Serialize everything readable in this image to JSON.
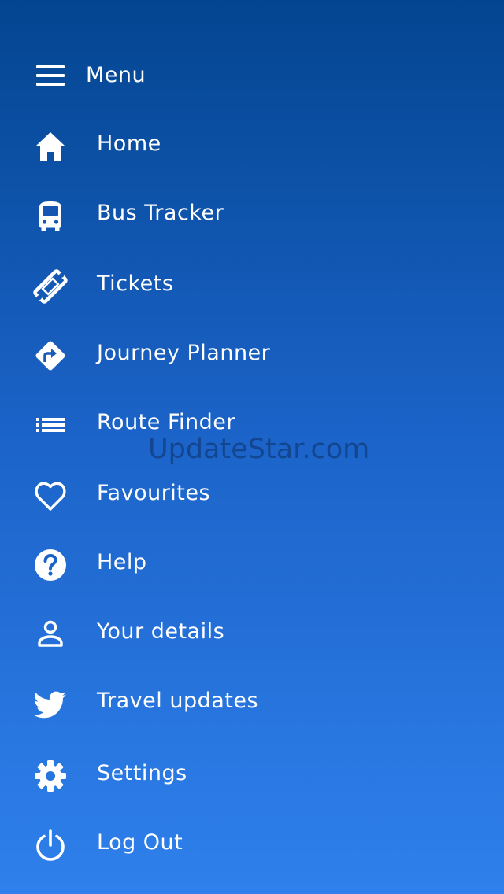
{
  "header": {
    "menu_title": "Menu",
    "menu_icon": "hamburger-icon"
  },
  "menu": {
    "items": [
      {
        "label": "Home",
        "icon": "home-icon"
      },
      {
        "label": "Bus Tracker",
        "icon": "bus-icon"
      },
      {
        "label": "Tickets",
        "icon": "ticket-icon"
      },
      {
        "label": "Journey Planner",
        "icon": "directions-icon"
      },
      {
        "label": "Route Finder",
        "icon": "list-icon"
      },
      {
        "label": "Favourites",
        "icon": "heart-icon"
      },
      {
        "label": "Help",
        "icon": "help-icon"
      },
      {
        "label": "Your details",
        "icon": "user-icon"
      },
      {
        "label": "Travel updates",
        "icon": "twitter-icon"
      },
      {
        "label": "Settings",
        "icon": "gear-icon"
      },
      {
        "label": "Log Out",
        "icon": "power-icon"
      }
    ]
  },
  "watermark": "UpdateStar.com",
  "colors": {
    "gradient_top": "#034590",
    "gradient_bottom": "#2f80ec",
    "text": "#ffffff"
  }
}
